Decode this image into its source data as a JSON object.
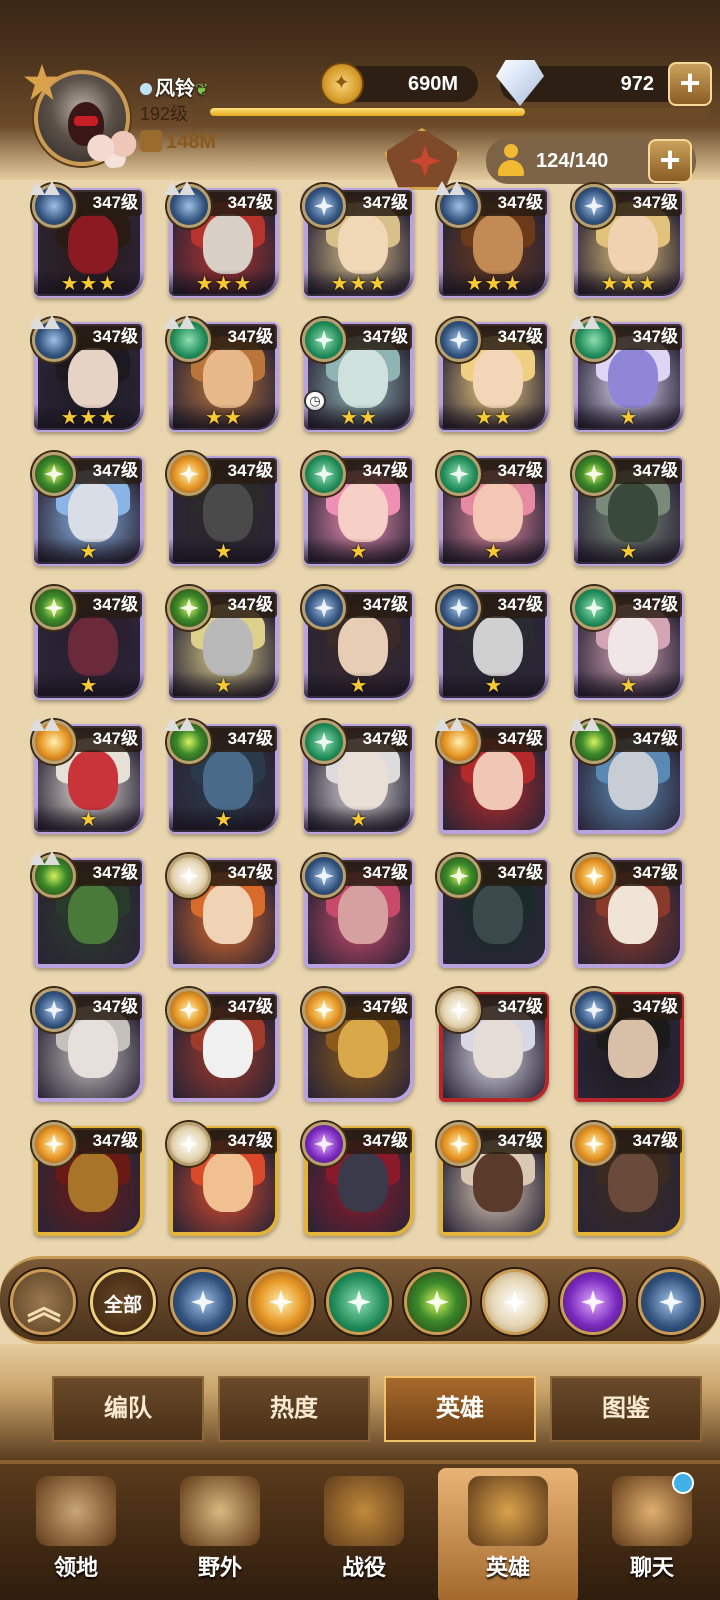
{
  "player": {
    "name": "风铃",
    "level": "192级",
    "power": "148M",
    "xp_progress": 0.63
  },
  "currencies": {
    "gold": "690M",
    "gems": "972"
  },
  "roster": "124/140",
  "heroes": [
    {
      "level": "347级",
      "faction": "blue",
      "stars": "★★★",
      "frame": "purple",
      "wings": true,
      "colors": [
        "#8b1a22",
        "#2a1a14"
      ]
    },
    {
      "level": "347级",
      "faction": "blue",
      "stars": "★★★",
      "frame": "purple",
      "wings": true,
      "colors": [
        "#d8cfc6",
        "#b7332d"
      ]
    },
    {
      "level": "347级",
      "faction": "blue",
      "stars": "★★★",
      "frame": "purple",
      "wings": false,
      "colors": [
        "#f0d7b5",
        "#d8c08a"
      ]
    },
    {
      "level": "347级",
      "faction": "blue",
      "stars": "★★★",
      "frame": "purple",
      "wings": true,
      "colors": [
        "#c28a55",
        "#6b3a18"
      ]
    },
    {
      "level": "347级",
      "faction": "blue",
      "stars": "★★★",
      "frame": "purple",
      "wings": false,
      "colors": [
        "#f1d2b0",
        "#e2c27a"
      ]
    },
    {
      "level": "347级",
      "faction": "blue",
      "stars": "★★★",
      "frame": "purple",
      "wings": true,
      "colors": [
        "#e6d3c6",
        "#1c1a20"
      ]
    },
    {
      "level": "347级",
      "faction": "green",
      "stars": "★★",
      "frame": "purple",
      "wings": true,
      "colors": [
        "#e7b98a",
        "#b9753a"
      ]
    },
    {
      "level": "347级",
      "faction": "green",
      "stars": "★★",
      "frame": "purple",
      "wings": false,
      "clock": true,
      "colors": [
        "#cfe1dc",
        "#8fb4b4"
      ]
    },
    {
      "level": "347级",
      "faction": "blue",
      "stars": "★★",
      "frame": "purple",
      "wings": false,
      "colors": [
        "#f2d6b7",
        "#f0cf80"
      ]
    },
    {
      "level": "347级",
      "faction": "green",
      "stars": "★",
      "frame": "purple",
      "wings": true,
      "colors": [
        "#8f86d8",
        "#dcd6f4"
      ]
    },
    {
      "level": "347级",
      "faction": "eye",
      "stars": "★",
      "frame": "purple",
      "wings": false,
      "colors": [
        "#d9dde6",
        "#8ab4e6"
      ]
    },
    {
      "level": "347级",
      "faction": "orange",
      "stars": "★",
      "frame": "purple",
      "wings": false,
      "colors": [
        "#4a4a4a",
        "#2a2a2a"
      ]
    },
    {
      "level": "347级",
      "faction": "green",
      "stars": "★",
      "frame": "purple",
      "wings": false,
      "colors": [
        "#f6d0c6",
        "#ef8fb4"
      ]
    },
    {
      "level": "347级",
      "faction": "green",
      "stars": "★",
      "frame": "purple",
      "wings": false,
      "colors": [
        "#f4c6b4",
        "#e58aa0"
      ]
    },
    {
      "level": "347级",
      "faction": "eye",
      "stars": "★",
      "frame": "purple",
      "wings": false,
      "colors": [
        "#3a4a3a",
        "#7a8a7a"
      ]
    },
    {
      "level": "347级",
      "faction": "eye",
      "stars": "★",
      "frame": "purple",
      "wings": false,
      "colors": [
        "#6a2a3a",
        "#2a2030"
      ]
    },
    {
      "level": "347级",
      "faction": "eye",
      "stars": "★",
      "frame": "purple",
      "wings": false,
      "colors": [
        "#b9b9b9",
        "#dcd08a"
      ]
    },
    {
      "level": "347级",
      "faction": "blue",
      "stars": "★",
      "frame": "purple",
      "wings": false,
      "colors": [
        "#e6cdb4",
        "#3a2a2a"
      ]
    },
    {
      "level": "347级",
      "faction": "blue",
      "stars": "★",
      "frame": "purple",
      "wings": false,
      "colors": [
        "#d0d0d0",
        "#2a2a32"
      ]
    },
    {
      "level": "347级",
      "faction": "green",
      "stars": "★",
      "frame": "purple",
      "wings": false,
      "colors": [
        "#f0e6e6",
        "#d4a4b4"
      ]
    },
    {
      "level": "347级",
      "faction": "orange",
      "stars": "★",
      "frame": "purple",
      "wings": true,
      "colors": [
        "#c8343a",
        "#e6e0d6"
      ]
    },
    {
      "level": "347级",
      "faction": "eye",
      "stars": "★",
      "frame": "purple",
      "wings": true,
      "colors": [
        "#4a6a8a",
        "#2a3a4a"
      ]
    },
    {
      "level": "347级",
      "faction": "green",
      "stars": "★",
      "frame": "purple",
      "wings": false,
      "colors": [
        "#eadfd6",
        "#dcdcdc"
      ]
    },
    {
      "level": "347级",
      "faction": "orange",
      "stars": "",
      "frame": "purple",
      "wings": true,
      "colors": [
        "#f0c6b4",
        "#b42a2a"
      ]
    },
    {
      "level": "347级",
      "faction": "eye",
      "stars": "",
      "frame": "purple",
      "wings": true,
      "colors": [
        "#c8ccd4",
        "#5a8ab4"
      ]
    },
    {
      "level": "347级",
      "faction": "eye",
      "stars": "",
      "frame": "purple",
      "wings": true,
      "colors": [
        "#4a7a3a",
        "#2a3a2a"
      ]
    },
    {
      "level": "347级",
      "faction": "white",
      "stars": "",
      "frame": "purple",
      "wings": false,
      "colors": [
        "#f0d2b4",
        "#d86a2a"
      ]
    },
    {
      "level": "347级",
      "faction": "blue",
      "stars": "",
      "frame": "purple",
      "wings": false,
      "colors": [
        "#d6a0a0",
        "#c84a6a"
      ]
    },
    {
      "level": "347级",
      "faction": "eye",
      "stars": "",
      "frame": "purple",
      "wings": false,
      "colors": [
        "#3a4a4a",
        "#1a2a2a"
      ]
    },
    {
      "level": "347级",
      "faction": "orange",
      "stars": "",
      "frame": "purple",
      "wings": false,
      "colors": [
        "#f0e4d6",
        "#8a3a2a"
      ]
    },
    {
      "level": "347级",
      "faction": "blue",
      "stars": "",
      "frame": "purple",
      "wings": false,
      "colors": [
        "#e6e0dc",
        "#c4c0bc"
      ]
    },
    {
      "level": "347级",
      "faction": "orange",
      "stars": "",
      "frame": "purple",
      "wings": false,
      "colors": [
        "#f0f0f0",
        "#a03a2a"
      ]
    },
    {
      "level": "347级",
      "faction": "orange",
      "stars": "",
      "frame": "purple",
      "wings": false,
      "colors": [
        "#d8a84a",
        "#8a5a1a"
      ]
    },
    {
      "level": "347级",
      "faction": "white",
      "stars": "",
      "frame": "red",
      "wings": false,
      "colors": [
        "#e6dcd6",
        "#d8d8e4"
      ]
    },
    {
      "level": "347级",
      "faction": "blue",
      "stars": "",
      "frame": "red",
      "wings": false,
      "colors": [
        "#d8c0a8",
        "#1a1a1a"
      ]
    },
    {
      "level": "347级",
      "faction": "orange",
      "stars": "",
      "frame": "gold",
      "wings": false,
      "colors": [
        "#a8742a",
        "#6a1a14"
      ]
    },
    {
      "level": "347级",
      "faction": "white",
      "stars": "",
      "frame": "gold",
      "wings": false,
      "colors": [
        "#f0c090",
        "#d84a2a"
      ]
    },
    {
      "level": "347级",
      "faction": "purple",
      "stars": "",
      "frame": "gold",
      "wings": false,
      "colors": [
        "#3a3a4a",
        "#8a1a2a"
      ]
    },
    {
      "level": "347级",
      "faction": "orange",
      "stars": "",
      "frame": "gold",
      "wings": false,
      "colors": [
        "#5a3a2a",
        "#d8c8b4"
      ]
    },
    {
      "level": "347级",
      "faction": "orange",
      "stars": "",
      "frame": "gold",
      "wings": false,
      "colors": [
        "#6a4a3a",
        "#3a2a20"
      ]
    }
  ],
  "filters": {
    "collapse_icon": "chevron-double-up-icon",
    "all_label": "全部",
    "factions": [
      {
        "name": "lightbearer-filter",
        "color": "blue"
      },
      {
        "name": "mauler-filter",
        "color": "orange"
      },
      {
        "name": "wilder-filter",
        "color": "green"
      },
      {
        "name": "graveborn-filter",
        "color": "eye"
      },
      {
        "name": "celestial-filter",
        "color": "white"
      },
      {
        "name": "hypogean-filter",
        "color": "purple"
      },
      {
        "name": "dimensional-filter",
        "color": "blue"
      }
    ]
  },
  "subtabs": [
    {
      "label": "编队",
      "active": false
    },
    {
      "label": "热度",
      "active": false
    },
    {
      "label": "英雄",
      "active": true
    },
    {
      "label": "图鉴",
      "active": false
    }
  ],
  "nav": [
    {
      "label": "领地",
      "icon": "castle-icon",
      "active": false,
      "badge": false
    },
    {
      "label": "野外",
      "icon": "map-scroll-icon",
      "active": false,
      "badge": false
    },
    {
      "label": "战役",
      "icon": "battle-shield-icon",
      "active": false,
      "badge": false
    },
    {
      "label": "英雄",
      "icon": "hero-helmet-icon",
      "active": true,
      "badge": false
    },
    {
      "label": "聊天",
      "icon": "chat-icon",
      "active": false,
      "badge": true
    }
  ]
}
